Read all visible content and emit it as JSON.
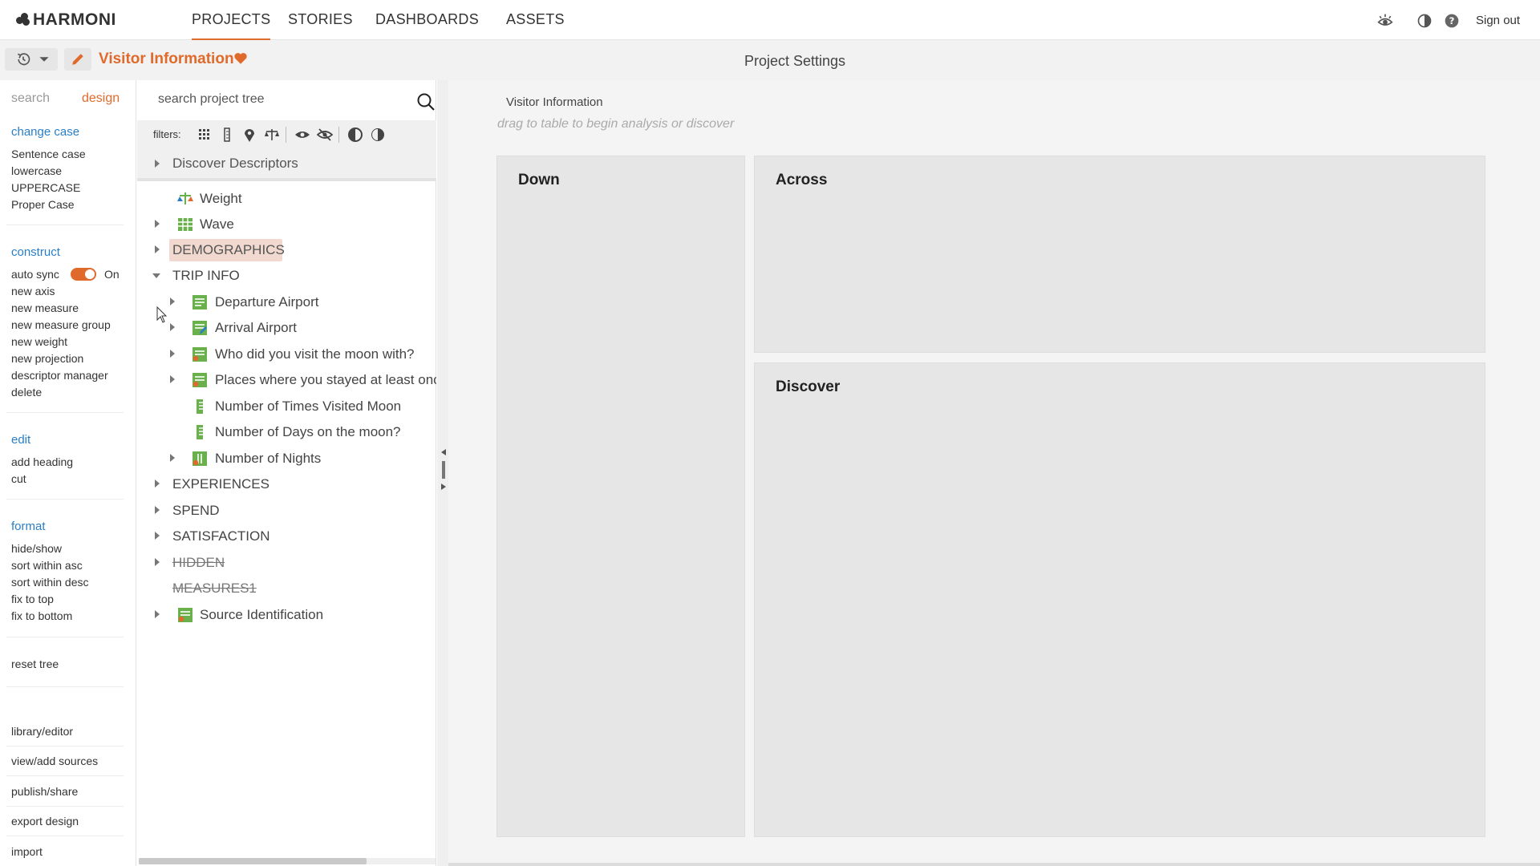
{
  "app": {
    "logo_text": "HARMONI"
  },
  "nav": {
    "tabs": [
      {
        "label": "PROJECTS",
        "active": true
      },
      {
        "label": "STORIES",
        "active": false
      },
      {
        "label": "DASHBOARDS",
        "active": false
      },
      {
        "label": "ASSETS",
        "active": false
      }
    ],
    "sign_out": "Sign out",
    "icons": [
      "view-eye-icon",
      "contrast-icon",
      "help-icon"
    ]
  },
  "subbar": {
    "project_name": "Visitor Information",
    "settings_title": "Project Settings"
  },
  "left": {
    "tabs": [
      {
        "label": "search"
      },
      {
        "label": "design",
        "active": true
      }
    ],
    "change_case": {
      "heading": "change case",
      "items": [
        "Sentence case",
        "lowercase",
        "UPPERCASE",
        "Proper Case"
      ]
    },
    "construct": {
      "heading": "construct",
      "auto_sync_label": "auto sync",
      "auto_sync_state": "On",
      "items": [
        "new axis",
        "new measure",
        "new measure group",
        "new weight",
        "new projection",
        "descriptor manager",
        "delete"
      ]
    },
    "edit": {
      "heading": "edit",
      "items": [
        "add heading",
        "cut"
      ]
    },
    "format": {
      "heading": "format",
      "items": [
        "hide/show",
        "sort within asc",
        "sort within desc",
        "fix to top",
        "fix to bottom"
      ]
    },
    "reset_tree": "reset tree",
    "bottom_links": [
      "library/editor",
      "view/add sources",
      "publish/share",
      "export design",
      "import"
    ]
  },
  "tree": {
    "search_placeholder": "search project tree",
    "filters_label": "filters:",
    "discover_descriptors": "Discover Descriptors",
    "rows": [
      {
        "label": "Weight",
        "icon": "weight-icon"
      },
      {
        "label": "Wave",
        "icon": "grid-table-icon"
      },
      {
        "label": "DEMOGRAPHICS"
      },
      {
        "label": "TRIP INFO"
      },
      {
        "label": "Departure Airport",
        "icon": "single-question-icon"
      },
      {
        "label": "Arrival Airport",
        "icon": "edit-question-icon"
      },
      {
        "label": "Who did you visit the moon with?",
        "icon": "multi-question-icon"
      },
      {
        "label": "Places where you stayed at least once",
        "icon": "multi-question-icon"
      },
      {
        "label": "Number of Times Visited Moon",
        "icon": "numeric-icon"
      },
      {
        "label": "Number of Days on the moon?",
        "icon": "numeric-icon"
      },
      {
        "label": "Number of Nights",
        "icon": "derived-numeric-icon"
      },
      {
        "label": "EXPERIENCES"
      },
      {
        "label": "SPEND"
      },
      {
        "label": "SATISFACTION"
      },
      {
        "label": "HIDDEN"
      },
      {
        "label": "MEASURES1"
      },
      {
        "label": "Source Identification",
        "icon": "source-id-icon"
      }
    ]
  },
  "main": {
    "table_label": "Visitor Information",
    "drag_hint": "drag to table to begin analysis or discover",
    "down": "Down",
    "across": "Across",
    "discover": "Discover"
  },
  "colors": {
    "accent": "#e06a2b",
    "link": "#2a7ec8",
    "icon_green": "#6ab04c",
    "highlight": "#f1d9cf"
  }
}
